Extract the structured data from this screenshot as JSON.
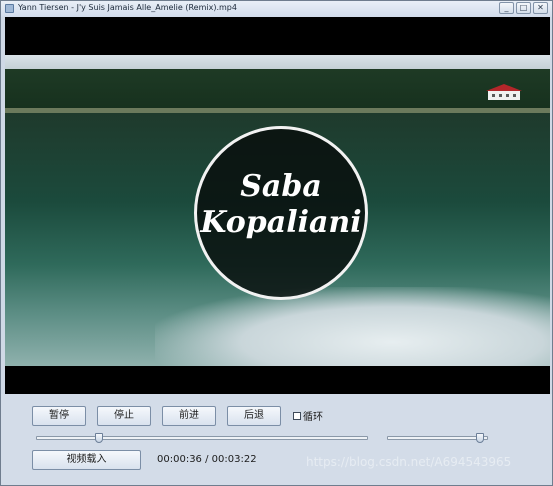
{
  "window": {
    "title": "Yann Tiersen - J'y Suis Jamais Alle_Amelie (Remix).mp4",
    "min_symbol": "_",
    "max_symbol": "□",
    "close_symbol": "✕"
  },
  "video": {
    "logo_line1": "Saba",
    "logo_line2": "Kopaliani"
  },
  "controls": {
    "pause_label": "暂停",
    "stop_label": "停止",
    "forward_label": "前进",
    "back_label": "后退",
    "loop_label": "循环",
    "loop_checked": false,
    "load_label": "视频载入",
    "current_time": "00:00:36",
    "time_separator": "/",
    "total_time": "00:03:22",
    "progress_fraction": 0.18,
    "volume_fraction": 0.97
  },
  "watermark": "https://blog.csdn.net/A694543965"
}
